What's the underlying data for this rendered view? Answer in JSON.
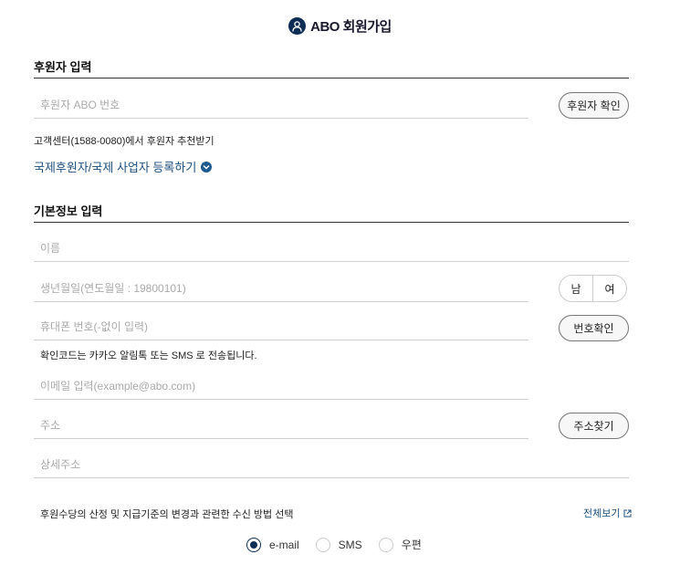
{
  "header": {
    "title": "ABO 회원가입",
    "icon": "user-icon",
    "icon_color": "#0e2d55"
  },
  "sponsor_section": {
    "title": "후원자 입력",
    "sponsor_input": {
      "placeholder": "후원자 ABO 번호",
      "value": ""
    },
    "confirm_button": "후원자 확인",
    "call_center_text": "고객센터(1588-0080)에서 후원자 추천받기",
    "international_link": "국제후원자/국제 사업자 등록하기"
  },
  "basic_section": {
    "title": "기본정보 입력",
    "name_input": {
      "placeholder": "이름",
      "value": ""
    },
    "birth_input": {
      "placeholder": "생년월일(연도월일 : 19800101)",
      "value": ""
    },
    "gender": {
      "male": "남",
      "female": "여"
    },
    "phone_input": {
      "placeholder": "휴대폰 번호(-없이 입력)",
      "value": ""
    },
    "phone_button": "번호확인",
    "phone_notice": "확인코드는 카카오 알림톡 또는 SMS 로 전송됩니다.",
    "email_input": {
      "placeholder": "이메일 입력(example@abo.com)",
      "value": ""
    },
    "address_input": {
      "placeholder": "주소",
      "value": ""
    },
    "address_button": "주소찾기",
    "address_detail_input": {
      "placeholder": "상세주소",
      "value": ""
    }
  },
  "notification": {
    "label": "후원수당의 산정 및 지급기준의 변경과 관련한 수신 방법 선택",
    "view_all": "전체보기",
    "options": [
      {
        "label": "e-mail",
        "checked": true
      },
      {
        "label": "SMS",
        "checked": false
      },
      {
        "label": "우편",
        "checked": false
      }
    ]
  },
  "colors": {
    "accent": "#0e2d55",
    "link": "#1d4f7f"
  }
}
